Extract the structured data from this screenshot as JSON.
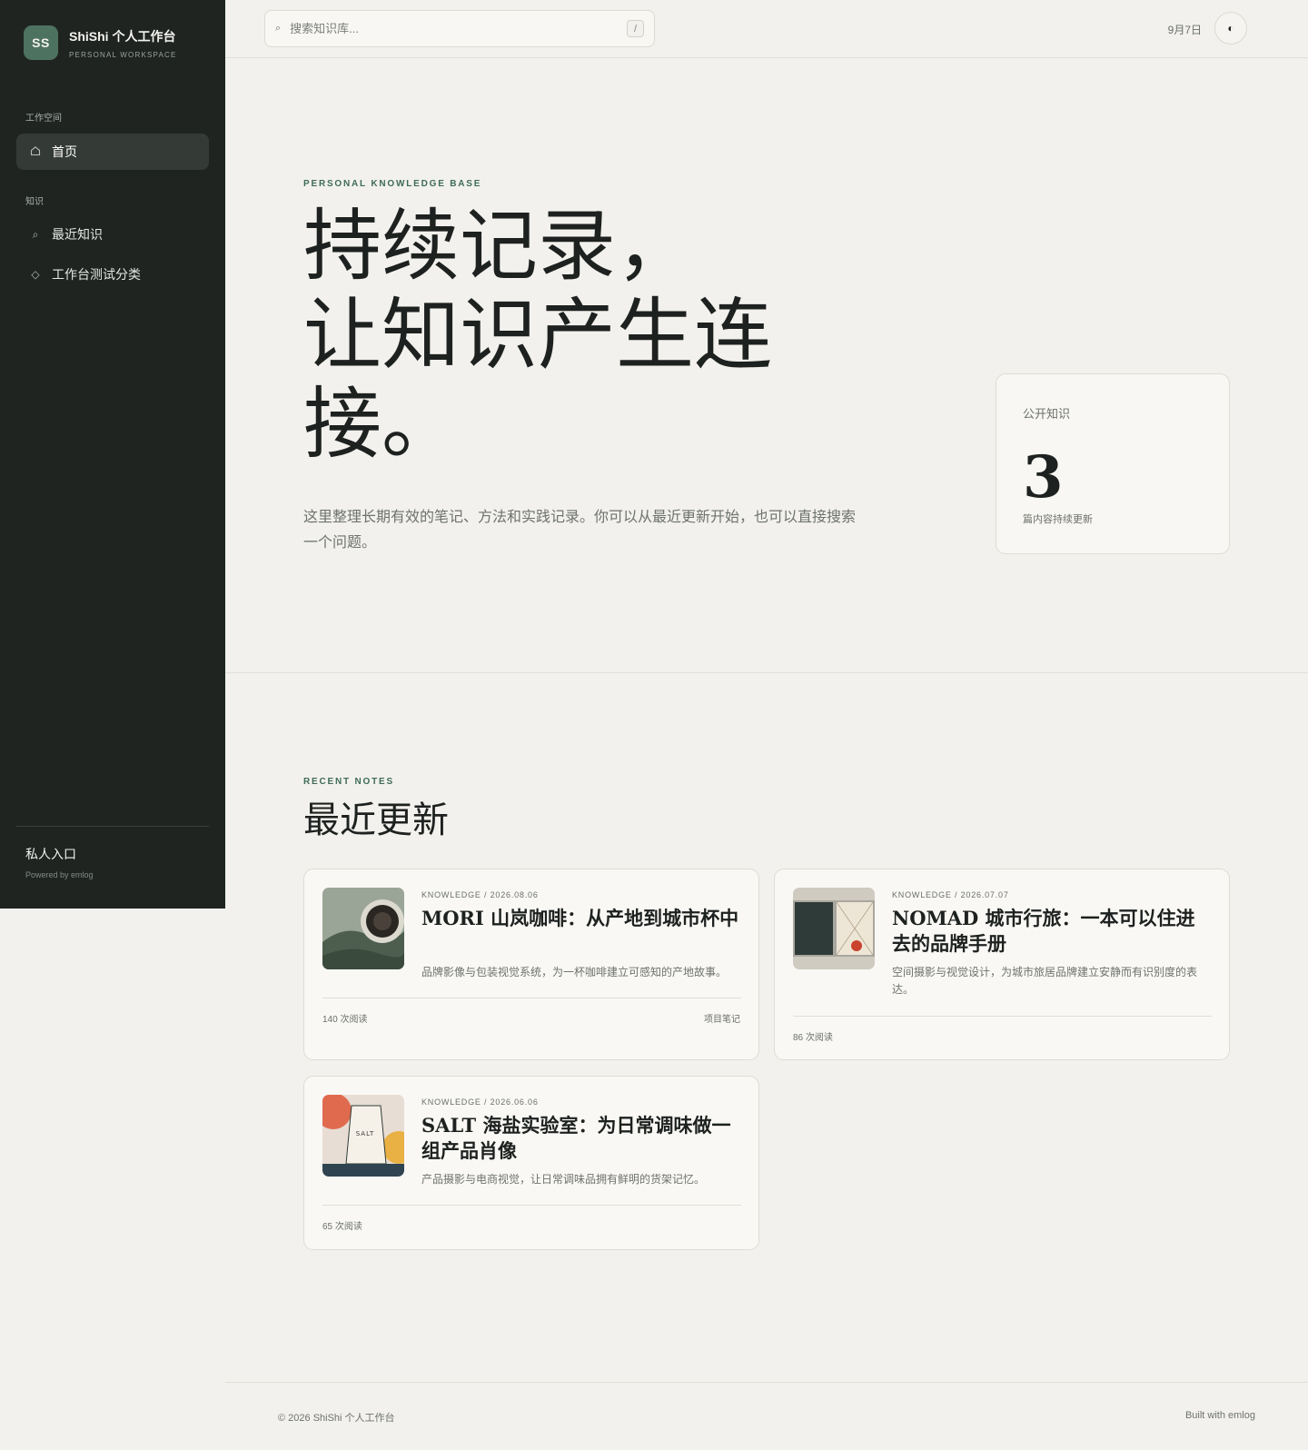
{
  "sidebar": {
    "logo": "SS",
    "title": "ShiShi 个人工作台",
    "subtitle": "PERSONAL WORKSPACE",
    "groups": [
      {
        "label": "工作空间",
        "items": [
          {
            "label": "首页",
            "icon": "home-icon",
            "active": true
          }
        ]
      },
      {
        "label": "知识",
        "items": [
          {
            "label": "最近知识",
            "icon": "search-icon"
          },
          {
            "label": "工作台测试分类",
            "icon": "diamond-icon"
          }
        ]
      }
    ],
    "private_entry": "私人入口",
    "powered": "Powered by emlog"
  },
  "topbar": {
    "search_placeholder": "搜索知识库...",
    "shortcut": "/",
    "date": "9月7日",
    "theme_icon": "contrast-icon"
  },
  "hero": {
    "eyebrow": "PERSONAL KNOWLEDGE BASE",
    "title_line1": "持续记录，",
    "title_line2": "让知识产生连",
    "title_line3": "接。",
    "description": "这里整理长期有效的笔记、方法和实践记录。你可以从最近更新开始，也可以直接搜索一个问题。",
    "stat": {
      "label": "公开知识",
      "value": "3",
      "caption": "篇内容持续更新"
    }
  },
  "recent": {
    "eyebrow": "RECENT NOTES",
    "title": "最近更新",
    "cards": [
      {
        "meta": "KNOWLEDGE / 2026.08.06",
        "title": "MORI 山岚咖啡：从产地到城市杯中",
        "desc": "品牌影像与包装视觉系统，为一杯咖啡建立可感知的产地故事。",
        "views": "140 次阅读",
        "category": "项目笔记"
      },
      {
        "meta": "KNOWLEDGE / 2026.07.07",
        "title": "NOMAD 城市行旅：一本可以住进去的品牌手册",
        "desc": "空间摄影与视觉设计，为城市旅居品牌建立安静而有识别度的表达。",
        "views": "86 次阅读",
        "category": ""
      },
      {
        "meta": "KNOWLEDGE / 2026.06.06",
        "title": "SALT 海盐实验室：为日常调味做一组产品肖像",
        "desc": "产品摄影与电商视觉，让日常调味品拥有鲜明的货架记忆。",
        "views": "65 次阅读",
        "category": "",
        "thumb_text": "SALT"
      }
    ]
  },
  "footer": {
    "copyright": "© 2026 ShiShi 个人工作台",
    "built": "Built with emlog"
  },
  "colors": {
    "sidebar_bg": "#1f2421",
    "accent": "#3f6b59",
    "page_bg": "#f2f1ed"
  }
}
